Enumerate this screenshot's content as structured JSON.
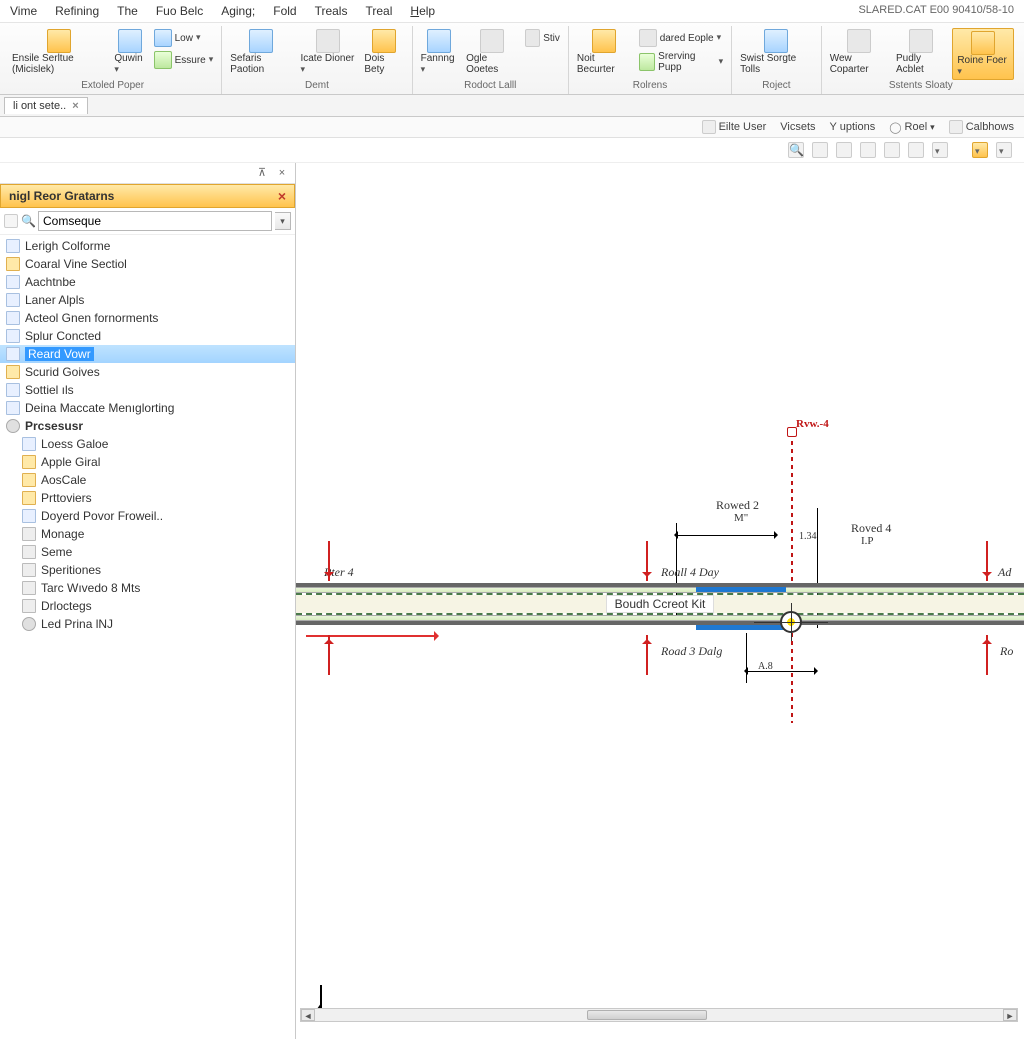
{
  "title_bar": "SLARED.CAT E00 90410/58-10",
  "menu": [
    "Vime",
    "Refining",
    "The",
    "Fuo Belc",
    "Aging;",
    "Fold",
    "Treals",
    "Treal",
    "Help"
  ],
  "ribbon": {
    "groups": [
      {
        "label": "Extoled   Poper",
        "buttons": [
          {
            "label": "Ensile Serltue (Micislek)",
            "icon": "orange",
            "dd": false
          },
          {
            "label": "Quwin",
            "icon": "blue",
            "dd": true
          },
          {
            "label": "Low",
            "icon": "blue",
            "small": true,
            "dd": true
          },
          {
            "label": "Essure",
            "icon": "green",
            "small": true,
            "dd": true
          }
        ]
      },
      {
        "label": "Demt",
        "buttons": [
          {
            "label": "Sefaris Paotion",
            "icon": "blue"
          },
          {
            "label": "Icate Dioner",
            "icon": "plain",
            "dd": true
          },
          {
            "label": "Dois Bety",
            "icon": "orange"
          }
        ]
      },
      {
        "label": "Rodoct   Lalll",
        "buttons": [
          {
            "label": "Fannng",
            "icon": "blue",
            "dd": true
          },
          {
            "label": "Ogle Ooetes",
            "icon": "plain"
          },
          {
            "label": "Stiv",
            "icon": "plain",
            "small": true
          }
        ]
      },
      {
        "label": "Rolrens",
        "buttons": [
          {
            "label": "Noit Becurter",
            "icon": "orange"
          },
          {
            "label": "dared Eople",
            "icon": "plain",
            "small": true,
            "dd": true
          },
          {
            "label": "Srerving Pupp",
            "icon": "green",
            "small": true,
            "dd": true
          }
        ]
      },
      {
        "label": "Roject",
        "buttons": [
          {
            "label": "Swist Sorgte Tolls",
            "icon": "blue"
          }
        ]
      },
      {
        "label": "Sstents  Sloaty",
        "buttons": [
          {
            "label": "Wew Coparter",
            "icon": "plain"
          },
          {
            "label": "Pudly Acblet",
            "icon": "plain"
          },
          {
            "label": "Roine Foer",
            "icon": "orange",
            "dd": true,
            "highlighted": true
          }
        ]
      }
    ]
  },
  "doc_tab": "li ont sete..",
  "sec_toolbar": [
    "Eilte User",
    "Vicsets",
    "Y uptions",
    "Roel",
    "Calbhows"
  ],
  "sidebar": {
    "panel_title": "nigl Reor Gratarns",
    "search_ph": "Comseque",
    "items": [
      {
        "label": "Lerigh Colforme",
        "icon": "doc"
      },
      {
        "label": "Coaral Vine Sectiol",
        "icon": "folder"
      },
      {
        "label": "Aachtnbe",
        "icon": "doc"
      },
      {
        "label": "Laner Alpls",
        "icon": "doc"
      },
      {
        "label": "Acteol Gnen fornorments",
        "icon": "doc"
      },
      {
        "label": "Splur Concted",
        "icon": "doc"
      },
      {
        "label": "Reard Vowr",
        "icon": "doc",
        "selected": true
      },
      {
        "label": "Scurid Goives",
        "icon": "folder"
      },
      {
        "label": "Sottiel  ıls",
        "icon": "doc"
      },
      {
        "label": "Deina Maccate Menıglorting",
        "icon": "doc"
      }
    ],
    "proc_header": "Prcsesusr",
    "proc_items": [
      {
        "label": "Loess Galoe",
        "icon": "doc"
      },
      {
        "label": "Apple Giral",
        "icon": "folder"
      },
      {
        "label": "AosCale",
        "icon": "folder"
      },
      {
        "label": "Prttoviers",
        "icon": "folder"
      },
      {
        "label": "Doyerd Povor Froweil..",
        "icon": "doc"
      },
      {
        "label": "Monage",
        "icon": "grid"
      },
      {
        "label": "Seme",
        "icon": "grid"
      },
      {
        "label": "Speritiones",
        "icon": "grid"
      },
      {
        "label": "Tarc Wıvedo 8 Mts",
        "icon": "grid"
      },
      {
        "label": "Drloctegs",
        "icon": "grid"
      },
      {
        "label": "Led Prina lNJ",
        "icon": "gear"
      }
    ]
  },
  "canvas": {
    "center_label": "Boudh Ccreot Kit",
    "labels": {
      "pter4": "Pter 4",
      "roall4": "Roall 4 Day",
      "road3": "Road 3 Dalg",
      "ad": "Ad",
      "ro": "Ro",
      "rowed2": "Rowed 2",
      "rowed2_sub": "M\"",
      "roved4": "Roved 4",
      "roved4_sub": "I.P",
      "rvw4": "Rvw.-4",
      "dim_134": "1.34",
      "dim_a8": "A.8"
    }
  }
}
